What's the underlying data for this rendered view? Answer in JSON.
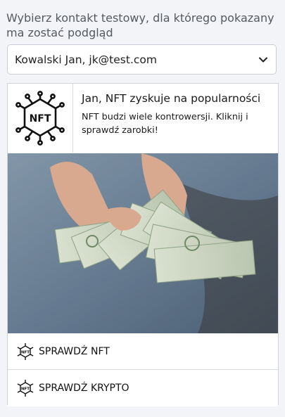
{
  "prompt": "Wybierz kontakt testowy, dla którego pokazany ma zostać podgląd",
  "contact_select": {
    "value": "Kowalski Jan, jk@test.com"
  },
  "card": {
    "logo_text": "NFT",
    "title": "Jan, NFT zyskuje na popularności",
    "subtitle": "NFT budzi wiele kontrowersji. Kliknij i sprawdź zarobki!",
    "buttons": [
      {
        "label": "SPRAWDŹ NFT",
        "icon": "nft-chip-icon"
      },
      {
        "label": "SPRAWDŹ KRYPTO",
        "icon": "nft-chip-icon"
      }
    ]
  },
  "icons": {
    "select_arrow": "chevron-down-icon"
  },
  "colors": {
    "background": "#f3f4f8",
    "prompt_text": "#555a60",
    "border": "#cfd3da"
  }
}
